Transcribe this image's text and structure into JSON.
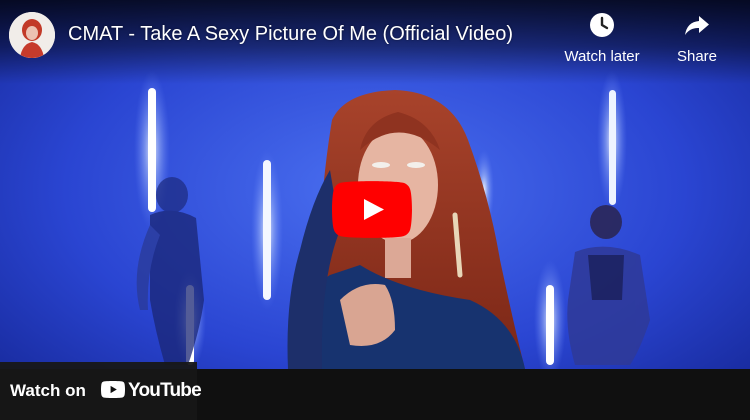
{
  "video": {
    "title": "CMAT - Take A Sexy Picture Of Me (Official Video)",
    "channel_avatar_icon": "channel-avatar"
  },
  "actions": {
    "watch_later_label": "Watch later",
    "watch_later_icon": "clock-icon",
    "share_label": "Share",
    "share_icon": "share-arrow-icon"
  },
  "play": {
    "icon": "play-icon",
    "color": "#ff0000"
  },
  "footer": {
    "watch_on_label": "Watch on",
    "brand_label": "YouTube",
    "brand_icon": "youtube-logo-icon"
  },
  "colors": {
    "scene_blue": "#1b2fb0",
    "brand_red": "#ff0000",
    "bar_dark": "#101010"
  }
}
